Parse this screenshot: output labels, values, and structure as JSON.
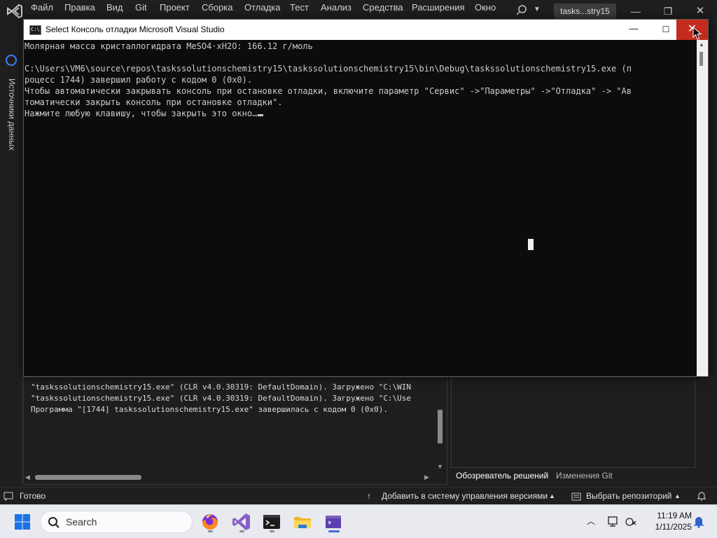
{
  "vs": {
    "menu": [
      "Файл",
      "Правка",
      "Вид",
      "Git",
      "Проект",
      "Сборка",
      "Отладка",
      "Тест",
      "Анализ",
      "Средства",
      "Расширения",
      "Окно"
    ],
    "solution_tab": "tasks...stry15",
    "left_panel_label": "Источники данных",
    "status_ready": "Готово",
    "status_add_to_vcs": "Добавить в систему управления версиями",
    "status_select_repo": "Выбрать репозиторий"
  },
  "output": {
    "lines": [
      "\"taskssolutionschemistry15.exe\" (CLR v4.0.30319: DefaultDomain). Загружено \"C:\\WIN",
      "\"taskssolutionschemistry15.exe\" (CLR v4.0.30319: DefaultDomain). Загружено \"C:\\Use",
      "Программа \"[1744] taskssolutionschemistry15.exe\" завершилась с кодом 0 (0x0)."
    ]
  },
  "solution_explorer": {
    "tabs": [
      "Обозреватель решений",
      "Изменения Git"
    ]
  },
  "console": {
    "title": "Select Консоль отладки Microsoft Visual Studio",
    "icon_text": "C:\\",
    "lines": [
      "Молярная масса кристаллогидрата MeSO4·xH2O: 166.12 г/моль",
      "",
      "C:\\Users\\VM6\\source\\repos\\taskssolutionschemistry15\\taskssolutionschemistry15\\bin\\Debug\\taskssolutionschemistry15.exe (п",
      "роцесс 1744) завершил работу с кодом 0 (0x0).",
      "Чтобы автоматически закрывать консоль при остановке отладки, включите параметр \"Сервис\" ->\"Параметры\" ->\"Отладка\" -> \"Ав",
      "томатически закрыть консоль при остановке отладки\".",
      "Нажмите любую клавишу, чтобы закрыть это окно…"
    ]
  },
  "taskbar": {
    "search_placeholder": "Search",
    "time": "11:19 AM",
    "date": "1/11/2025",
    "apps": [
      "firefox",
      "visual-studio",
      "terminal",
      "file-explorer",
      "console-debug"
    ]
  },
  "colors": {
    "close_red": "#c42b1c",
    "vs_purple": "#7c5cc4",
    "accent_blue": "#3f6ad8"
  }
}
